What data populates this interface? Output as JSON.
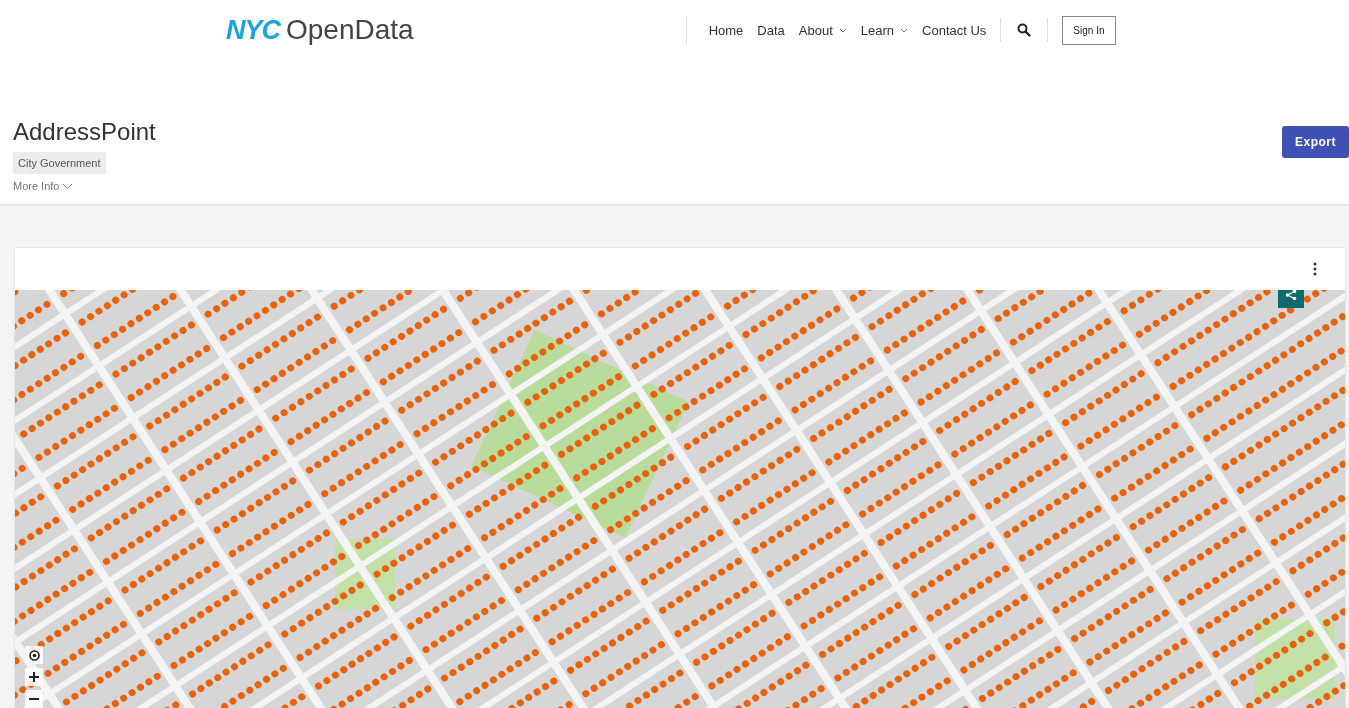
{
  "logo": {
    "mark": "NYC",
    "name": "OpenData"
  },
  "nav": [
    {
      "label": "Home",
      "dropdown": false
    },
    {
      "label": "Data",
      "dropdown": false
    },
    {
      "label": "About",
      "dropdown": true
    },
    {
      "label": "Learn",
      "dropdown": true
    },
    {
      "label": "Contact Us",
      "dropdown": false
    }
  ],
  "sign_in": "Sign In",
  "dataset": {
    "title": "AddressPoint",
    "category": "City Government",
    "more_info": "More Info",
    "export": "Export"
  }
}
